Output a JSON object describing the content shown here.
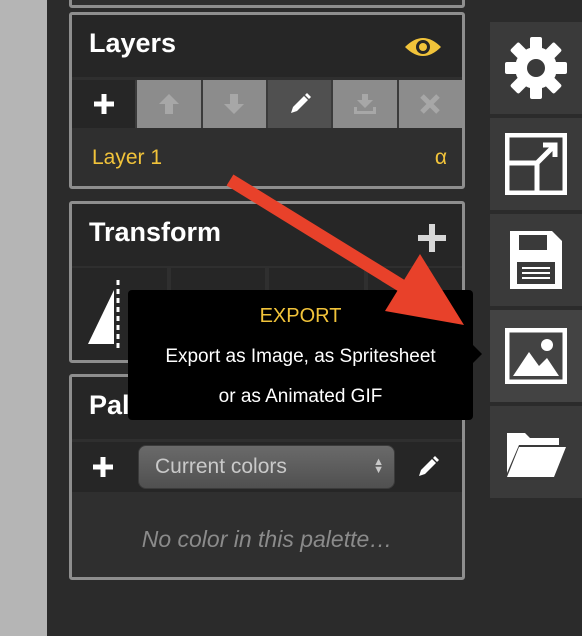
{
  "layers": {
    "title": "Layers",
    "visibility_icon": "eye-icon",
    "toolbar": [
      "plus-icon",
      "arrow-up-icon",
      "arrow-down-icon",
      "pencil-icon",
      "merge-down-icon",
      "close-icon"
    ],
    "items": [
      {
        "name": "Layer 1",
        "alpha": "α"
      }
    ]
  },
  "transform": {
    "title": "Transform",
    "add_icon": "plus-icon"
  },
  "palettes": {
    "title": "Palettes",
    "select_value": "Current colors",
    "empty_text": "No color in this palette…"
  },
  "tooltip": {
    "title": "EXPORT",
    "line1": "Export as Image, as Spritesheet",
    "line2": "or as Animated GIF"
  },
  "sidebar": [
    "gear-icon",
    "resize-icon",
    "save-icon",
    "image-icon",
    "folder-icon"
  ],
  "colors": {
    "accent": "#f1c33a",
    "annotation_arrow": "#e8412a",
    "panel_border": "#8e8e8e"
  }
}
